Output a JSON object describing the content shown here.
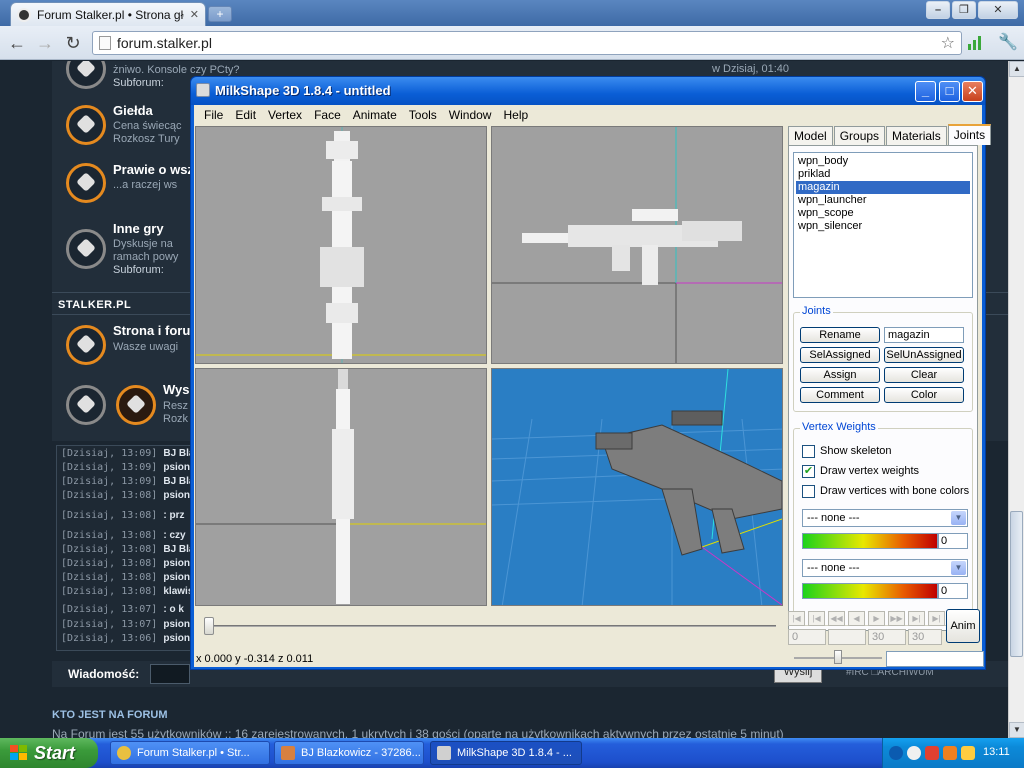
{
  "browser": {
    "tab_title": "Forum Stalker.pl • Strona głów",
    "url": "forum.stalker.pl"
  },
  "forum": {
    "top_desc": "żniwo. Konsole czy PCty?",
    "top_sub_label": "Subforum:",
    "last_post": "w Dzisiaj, 01:40",
    "items": [
      {
        "title": "Giełda",
        "desc1": "Cena świecąc",
        "desc2": "Rozkosz Tury"
      },
      {
        "title": "Prawie o wsz",
        "desc1": "...a raczej ws",
        "desc2": ""
      },
      {
        "title": "Inne gry",
        "desc1": "Dyskusje na",
        "desc2": "ramach powy",
        "sub": "Subforum:"
      }
    ],
    "section": "STALKER.PL",
    "section_items": [
      {
        "title": "Strona i foru",
        "desc1": "Wasze uwagi"
      },
      {
        "title": "Wys",
        "desc1": "Resz",
        "desc2": "Rozk"
      }
    ],
    "chat": [
      {
        "time": "[Dzisiaj, 13:09]",
        "user": "BJ Blaz"
      },
      {
        "time": "[Dzisiaj, 13:09]",
        "user": "psionik"
      },
      {
        "time": "[Dzisiaj, 13:09]",
        "user": "BJ Blaz"
      },
      {
        "time": "[Dzisiaj, 13:08]",
        "user": "psionik"
      },
      {
        "time": "[Dzisiaj, 13:08]",
        "user": ": prz"
      },
      {
        "time": "[Dzisiaj, 13:08]",
        "user": ": czy"
      },
      {
        "time": "[Dzisiaj, 13:08]",
        "user": "BJ Blaz"
      },
      {
        "time": "[Dzisiaj, 13:08]",
        "user": "psionik"
      },
      {
        "time": "[Dzisiaj, 13:08]",
        "user": "psionik"
      },
      {
        "time": "[Dzisiaj, 13:08]",
        "user": "klawisz"
      },
      {
        "time": "[Dzisiaj, 13:07]",
        "user": ": o k"
      },
      {
        "time": "[Dzisiaj, 13:07]",
        "user": "psionik"
      },
      {
        "time": "[Dzisiaj, 13:06]",
        "user": "psionik"
      }
    ],
    "message_label": "Wiadomość:",
    "send_label": "Wyślij",
    "archive_label": "#IRC □ARCHIWUM",
    "who_head": "KTO JEST NA FORUM",
    "who_text": "Na Forum jest 55 użytkowników :: 16 zarejestrowanych, 1 ukrytych i 38 gości (oparte na użytkownikach aktywnych przez ostatnie 5 minut)"
  },
  "milkshape": {
    "title": "MilkShape 3D 1.8.4 - untitled",
    "menu": [
      "File",
      "Edit",
      "Vertex",
      "Face",
      "Animate",
      "Tools",
      "Window",
      "Help"
    ],
    "tabs": [
      "Model",
      "Groups",
      "Materials",
      "Joints"
    ],
    "active_tab": "Joints",
    "joints": [
      "wpn_body",
      "priklad",
      "magazin",
      "wpn_launcher",
      "wpn_scope",
      "wpn_silencer"
    ],
    "selected_joint": "magazin",
    "joints_group_label": "Joints",
    "rename_label": "Rename",
    "rename_value": "magazin",
    "selassigned_label": "SelAssigned",
    "selunassigned_label": "SelUnAssigned",
    "assign_label": "Assign",
    "clear_label": "Clear",
    "comment_label": "Comment",
    "color_label": "Color",
    "vw_group_label": "Vertex Weights",
    "show_skeleton_label": "Show skeleton",
    "show_skeleton": false,
    "draw_vertex_weights_label": "Draw vertex weights",
    "draw_vertex_weights": true,
    "draw_bone_colors_label": "Draw vertices with bone colors",
    "draw_bone_colors": false,
    "dropdown1": "--- none ---",
    "weight1": "0",
    "dropdown2": "--- none ---",
    "weight2": "0",
    "frame_start": "0",
    "frame_end": "30",
    "frame_total": "30",
    "anim_label": "Anim",
    "coords": "x 0.000 y -0.314 z 0.011"
  },
  "taskbar": {
    "start_label": "Start",
    "tasks": [
      {
        "label": "Forum Stalker.pl • Str...",
        "color": "#e8c040"
      },
      {
        "label": "BJ Blazkowicz - 37286...",
        "color": "#d88040"
      },
      {
        "label": "MilkShape 3D 1.8.4 - ...",
        "color": "#d0d0d0"
      }
    ],
    "clock": "13:11"
  }
}
